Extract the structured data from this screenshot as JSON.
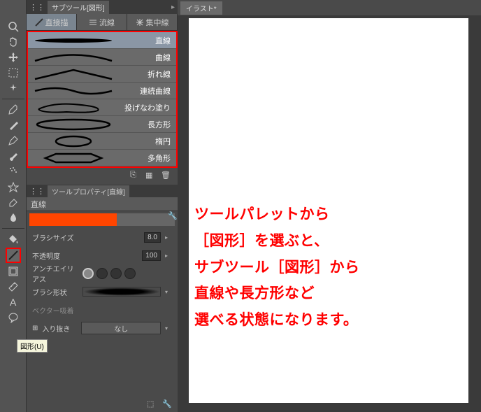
{
  "canvas": {
    "tab_title": "イラスト*"
  },
  "toolbar": {
    "tooltip_figure": "図形(U)"
  },
  "subtool_panel": {
    "title": "サブツール[図形]",
    "tabs": [
      {
        "label": "直接描",
        "active": true
      },
      {
        "label": "流線",
        "active": false
      },
      {
        "label": "集中線",
        "active": false
      }
    ],
    "items": [
      {
        "label": "直線",
        "preview": "line",
        "selected": true
      },
      {
        "label": "曲線",
        "preview": "curve",
        "selected": false
      },
      {
        "label": "折れ線",
        "preview": "polyline",
        "selected": false
      },
      {
        "label": "連続曲線",
        "preview": "spline",
        "selected": false
      },
      {
        "label": "投げなわ塗り",
        "preview": "lasso",
        "selected": false
      },
      {
        "label": "長方形",
        "preview": "rect",
        "selected": false
      },
      {
        "label": "楕円",
        "preview": "ellipse",
        "selected": false
      },
      {
        "label": "多角形",
        "preview": "polygon",
        "selected": false
      }
    ]
  },
  "tool_property": {
    "title": "ツールプロパティ[直線]",
    "tool_name": "直線",
    "brush_size": {
      "label": "ブラシサイズ",
      "value": "8.0"
    },
    "opacity": {
      "label": "不透明度",
      "value": "100"
    },
    "antialias": {
      "label": "アンチエイリアス"
    },
    "brush_shape": {
      "label": "ブラシ形状"
    },
    "vector_snap": {
      "label": "ベクター吸着"
    },
    "stroke": {
      "label": "入り抜き",
      "value": "なし"
    }
  },
  "annotation": {
    "line1": "ツールパレットから",
    "line2": "［図形］を選ぶと、",
    "line3": "サブツール［図形］から",
    "line4": "直線や長方形など",
    "line5": "選べる状態になります。"
  }
}
